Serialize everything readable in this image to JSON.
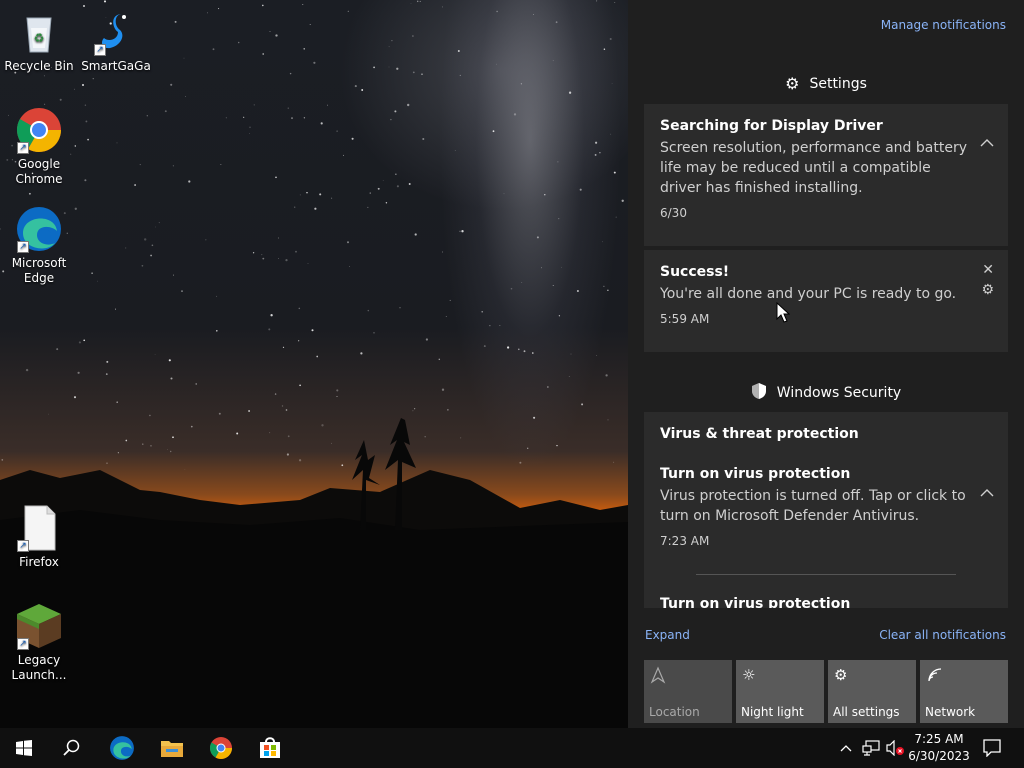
{
  "desktop": {
    "icons": [
      {
        "label": "Recycle Bin",
        "icon": "recycle-bin-icon"
      },
      {
        "label": "SmartGaGa",
        "icon": "swan-icon"
      },
      {
        "label": "Google Chrome",
        "icon": "chrome-icon"
      },
      {
        "label": "Microsoft Edge",
        "icon": "edge-icon"
      },
      {
        "label": "Firefox",
        "icon": "blank-file-icon"
      },
      {
        "label": "Legacy Launch...",
        "icon": "minecraft-block-icon"
      }
    ]
  },
  "action_center": {
    "manage_label": "Manage notifications",
    "groups": [
      {
        "title": "Settings",
        "icon": "gear-icon",
        "notifications": [
          {
            "title": "Searching for Display Driver",
            "body": "Screen resolution, performance and battery life may be reduced until a compatible driver has finished installing.",
            "time": "6/30"
          },
          {
            "title": "Success!",
            "body": "You're all done and your PC is ready to go.",
            "time": "5:59 AM"
          }
        ]
      },
      {
        "title": "Windows Security",
        "icon": "shield-icon",
        "subheading": "Virus & threat protection",
        "notifications": [
          {
            "title": "Turn on virus protection",
            "body": "Virus protection is turned off. Tap or click to turn on Microsoft Defender Antivirus.",
            "time": "7:23 AM"
          },
          {
            "title": "Turn on virus protection"
          }
        ]
      }
    ],
    "expand_label": "Expand",
    "clear_label": "Clear all notifications",
    "quick_actions": [
      {
        "label": "Location",
        "icon": "location-icon",
        "enabled": false
      },
      {
        "label": "Night light",
        "icon": "brightness-icon",
        "enabled": true
      },
      {
        "label": "All settings",
        "icon": "gear-icon",
        "enabled": true
      },
      {
        "label": "Network",
        "icon": "network-icon",
        "enabled": true
      }
    ]
  },
  "taskbar": {
    "time": "7:25 AM",
    "date": "6/30/2023"
  },
  "colors": {
    "accent_link": "#8ab4f8",
    "panel_bg": "#1f1f1f",
    "card_bg": "#2b2b2b",
    "taskbar_bg": "#101010"
  }
}
